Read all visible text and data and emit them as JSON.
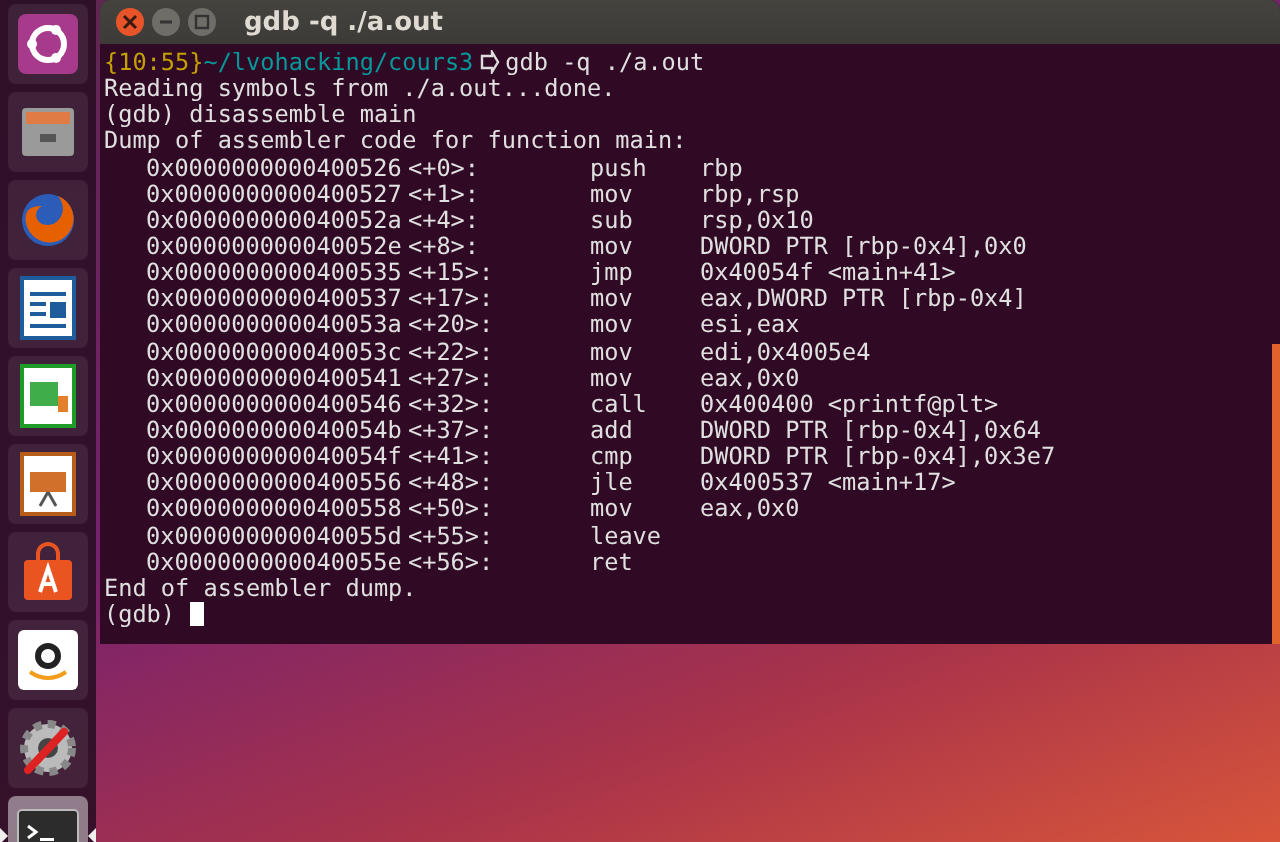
{
  "launcher": {
    "items": [
      {
        "kind": "ubuntu",
        "selected": false,
        "running": false
      },
      {
        "kind": "files",
        "selected": false,
        "running": false
      },
      {
        "kind": "firefox",
        "selected": false,
        "running": false
      },
      {
        "kind": "writer",
        "selected": false,
        "running": false
      },
      {
        "kind": "calc",
        "selected": false,
        "running": false
      },
      {
        "kind": "impress",
        "selected": false,
        "running": false
      },
      {
        "kind": "software",
        "selected": false,
        "running": false
      },
      {
        "kind": "amazon",
        "selected": false,
        "running": false
      },
      {
        "kind": "settings",
        "selected": false,
        "running": false
      },
      {
        "kind": "terminal",
        "selected": true,
        "running": true
      }
    ]
  },
  "window": {
    "title": "gdb -q ./a.out"
  },
  "terminal": {
    "prompt": {
      "time": "{10:55}",
      "path": "~/lvohacking/cours3",
      "command": "gdb -q ./a.out"
    },
    "lines": [
      {
        "kind": "text",
        "text": "Reading symbols from ./a.out...done."
      },
      {
        "kind": "text",
        "text": "(gdb) disassemble main"
      },
      {
        "kind": "text",
        "text": "Dump of assembler code for function main:"
      },
      {
        "kind": "asm",
        "address": "0x0000000000400526",
        "offset": "<+0>:",
        "mnemonic": "push",
        "operands": "rbp"
      },
      {
        "kind": "asm",
        "address": "0x0000000000400527",
        "offset": "<+1>:",
        "mnemonic": "mov",
        "operands": "rbp,rsp"
      },
      {
        "kind": "asm",
        "address": "0x000000000040052a",
        "offset": "<+4>:",
        "mnemonic": "sub",
        "operands": "rsp,0x10"
      },
      {
        "kind": "asm",
        "address": "0x000000000040052e",
        "offset": "<+8>:",
        "mnemonic": "mov",
        "operands": "DWORD PTR [rbp-0x4],0x0"
      },
      {
        "kind": "asm",
        "address": "0x0000000000400535",
        "offset": "<+15>:",
        "mnemonic": "jmp",
        "operands": "0x40054f <main+41>"
      },
      {
        "kind": "asm",
        "address": "0x0000000000400537",
        "offset": "<+17>:",
        "mnemonic": "mov",
        "operands": "eax,DWORD PTR [rbp-0x4]"
      },
      {
        "kind": "asm",
        "address": "0x000000000040053a",
        "offset": "<+20>:",
        "mnemonic": "mov",
        "operands": "esi,eax"
      },
      {
        "kind": "asm",
        "address": "0x000000000040053c",
        "offset": "<+22>:",
        "mnemonic": "mov",
        "operands": "edi,0x4005e4"
      },
      {
        "kind": "asm",
        "address": "0x0000000000400541",
        "offset": "<+27>:",
        "mnemonic": "mov",
        "operands": "eax,0x0"
      },
      {
        "kind": "asm",
        "address": "0x0000000000400546",
        "offset": "<+32>:",
        "mnemonic": "call",
        "operands": "0x400400 <printf@plt>"
      },
      {
        "kind": "asm",
        "address": "0x000000000040054b",
        "offset": "<+37>:",
        "mnemonic": "add",
        "operands": "DWORD PTR [rbp-0x4],0x64"
      },
      {
        "kind": "asm",
        "address": "0x000000000040054f",
        "offset": "<+41>:",
        "mnemonic": "cmp",
        "operands": "DWORD PTR [rbp-0x4],0x3e7"
      },
      {
        "kind": "asm",
        "address": "0x0000000000400556",
        "offset": "<+48>:",
        "mnemonic": "jle",
        "operands": "0x400537 <main+17>"
      },
      {
        "kind": "asm",
        "address": "0x0000000000400558",
        "offset": "<+50>:",
        "mnemonic": "mov",
        "operands": "eax,0x0"
      },
      {
        "kind": "asm",
        "address": "0x000000000040055d",
        "offset": "<+55>:",
        "mnemonic": "leave"
      },
      {
        "kind": "asm",
        "address": "0x000000000040055e",
        "offset": "<+56>:",
        "mnemonic": "ret"
      },
      {
        "kind": "text",
        "text": "End of assembler dump."
      },
      {
        "kind": "input",
        "text": "(gdb)"
      }
    ]
  }
}
